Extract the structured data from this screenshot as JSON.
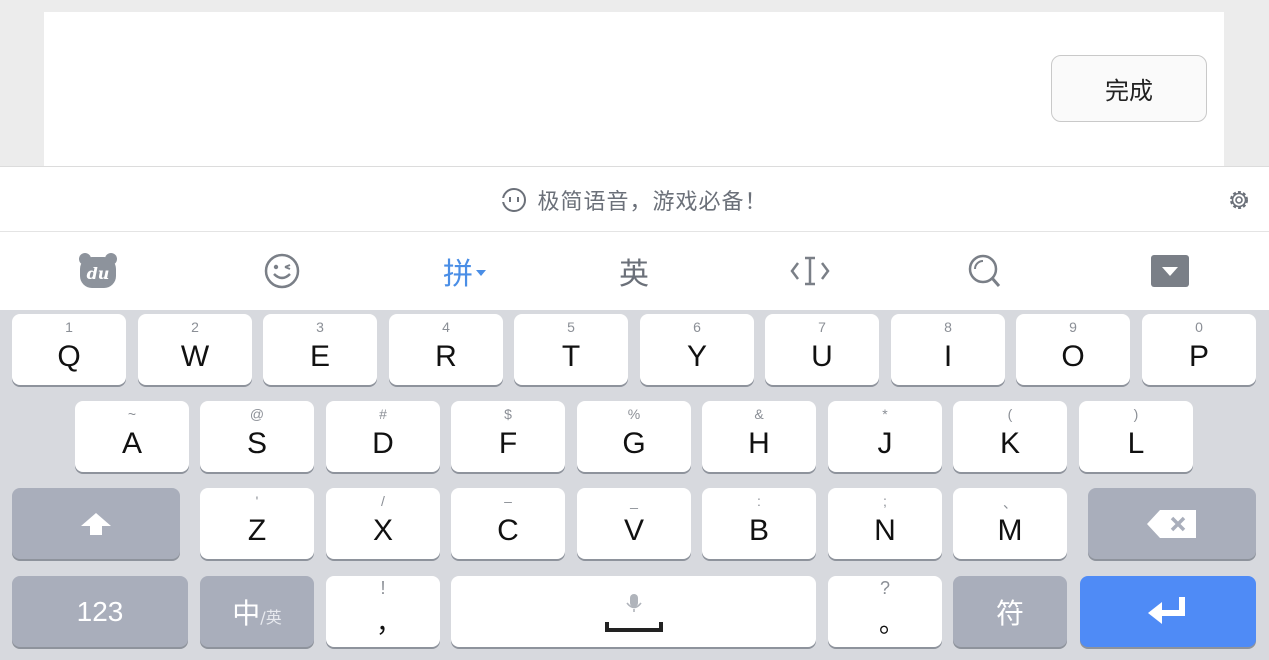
{
  "input_panel": {
    "done_label": "完成"
  },
  "suggestion_bar": {
    "text": "极简语音，游戏必备！",
    "icons": [
      "voice-face-icon",
      "gear-icon"
    ]
  },
  "toolbar": {
    "items": [
      {
        "name": "du-logo-icon"
      },
      {
        "name": "emoji-icon"
      },
      {
        "label": "拼",
        "active": true
      },
      {
        "label": "英"
      },
      {
        "name": "cursor-icon"
      },
      {
        "name": "search-icon"
      },
      {
        "name": "hide-keyboard-icon"
      }
    ]
  },
  "keyboard": {
    "row1": [
      {
        "key": "Q",
        "hint": "1"
      },
      {
        "key": "W",
        "hint": "2"
      },
      {
        "key": "E",
        "hint": "3"
      },
      {
        "key": "R",
        "hint": "4"
      },
      {
        "key": "T",
        "hint": "5"
      },
      {
        "key": "Y",
        "hint": "6"
      },
      {
        "key": "U",
        "hint": "7"
      },
      {
        "key": "I",
        "hint": "8"
      },
      {
        "key": "O",
        "hint": "9"
      },
      {
        "key": "P",
        "hint": "0"
      }
    ],
    "row2": [
      {
        "key": "A",
        "hint": "~"
      },
      {
        "key": "S",
        "hint": "@"
      },
      {
        "key": "D",
        "hint": "#"
      },
      {
        "key": "F",
        "hint": "$"
      },
      {
        "key": "G",
        "hint": "%"
      },
      {
        "key": "H",
        "hint": "&"
      },
      {
        "key": "J",
        "hint": "*"
      },
      {
        "key": "K",
        "hint": "("
      },
      {
        "key": "L",
        "hint": ")"
      }
    ],
    "row3": [
      {
        "key": "Z",
        "hint": "'"
      },
      {
        "key": "X",
        "hint": "/"
      },
      {
        "key": "C",
        "hint": "–"
      },
      {
        "key": "V",
        "hint": "_"
      },
      {
        "key": "B",
        "hint": ":"
      },
      {
        "key": "N",
        "hint": ";"
      },
      {
        "key": "M",
        "hint": "、"
      }
    ],
    "row4": {
      "numbers_label": "123",
      "lang_main": "中",
      "lang_alt": "/英",
      "comma": {
        "key": "，",
        "hint": "!"
      },
      "period": {
        "key": "。",
        "hint": "?"
      },
      "symbols_label": "符"
    },
    "colors": {
      "accent": "#4f8bf6",
      "function_key": "#a9aebb",
      "background": "#d7d9de"
    }
  }
}
